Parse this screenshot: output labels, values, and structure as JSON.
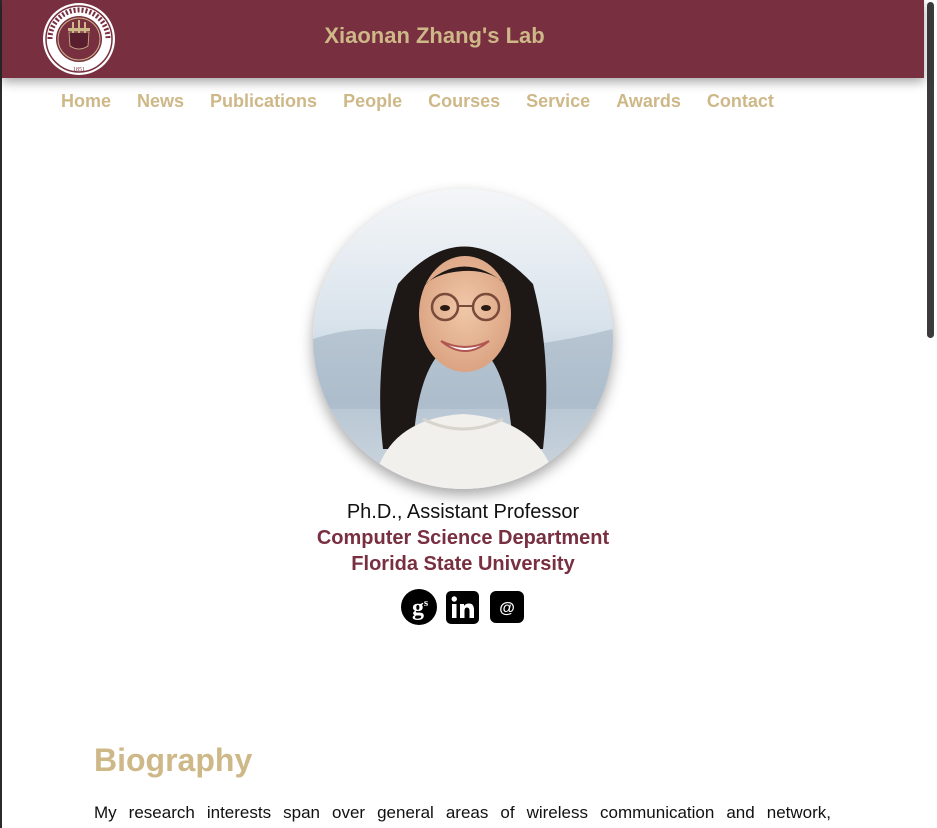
{
  "header": {
    "site_title": "Xiaonan Zhang's Lab",
    "seal_text_top": "FLORIDA STATE UNIVERSITY",
    "seal_year": "1851"
  },
  "nav": {
    "items": [
      {
        "label": "Home"
      },
      {
        "label": "News"
      },
      {
        "label": "Publications"
      },
      {
        "label": "People"
      },
      {
        "label": "Courses"
      },
      {
        "label": "Service"
      },
      {
        "label": "Awards"
      },
      {
        "label": "Contact"
      }
    ]
  },
  "profile": {
    "position": "Ph.D., Assistant Professor",
    "department": "Computer Science Department",
    "university": "Florida State University"
  },
  "social": {
    "icons": [
      "google-scholar-icon",
      "linkedin-icon",
      "email-icon"
    ]
  },
  "biography": {
    "heading": "Biography",
    "text": "My research interests span over general areas of wireless communication and network,"
  },
  "colors": {
    "garnet": "#782f40",
    "gold": "#ceb888"
  }
}
